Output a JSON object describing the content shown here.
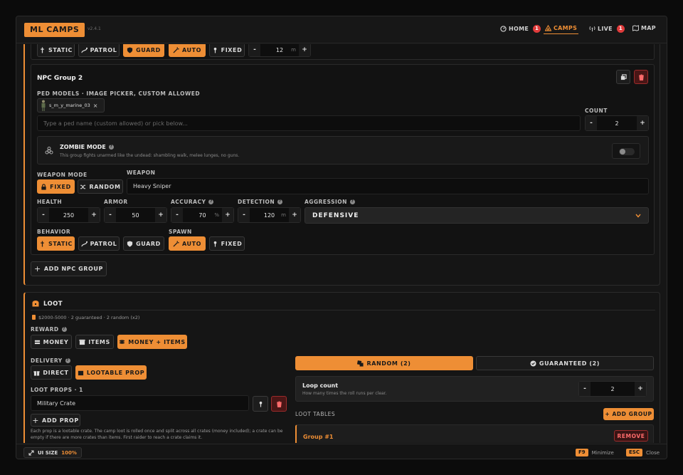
{
  "app": {
    "name": "ML CAMPS",
    "version": "v2.4.1"
  },
  "nav": {
    "home": "HOME",
    "home_badge": "1",
    "camps": "CAMPS",
    "live": "LIVE",
    "live_badge": "1",
    "map": "MAP"
  },
  "top_partial": {
    "static": "STATIC",
    "patrol": "PATROL",
    "guard": "GUARD",
    "auto": "AUTO",
    "fixed": "FIXED",
    "minus": "-",
    "plus": "+",
    "value": "12",
    "unit": "m"
  },
  "npc_group": {
    "title": "NPC Group 2",
    "ped_label": "PED MODELS · IMAGE PICKER, CUSTOM ALLOWED",
    "ped_chip": "s_m_y_marine_03",
    "ped_chip_remove": "×",
    "ped_placeholder": "Type a ped name (custom allowed) or pick below...",
    "count_label": "COUNT",
    "count": "2",
    "zombie_title": "ZOMBIE MODE",
    "zombie_desc": "This group fights unarmed like the undead: shambling walk, melee lunges, no guns.",
    "weapon_mode_label": "WEAPON MODE",
    "fixed": "FIXED",
    "random": "RANDOM",
    "weapon_label": "WEAPON",
    "weapon": "Heavy Sniper",
    "health_label": "HEALTH",
    "health": "250",
    "armor_label": "ARMOR",
    "armor": "50",
    "accuracy_label": "ACCURACY",
    "accuracy": "70",
    "accuracy_unit": "%",
    "detection_label": "DETECTION",
    "detection": "120",
    "detection_unit": "m",
    "aggression_label": "AGGRESSION",
    "aggression": "DEFENSIVE",
    "behavior_label": "BEHAVIOR",
    "static": "STATIC",
    "patrol": "PATROL",
    "guard": "GUARD",
    "spawn_label": "SPAWN",
    "auto": "AUTO",
    "spawn_fixed": "FIXED",
    "minus": "-",
    "plus": "+"
  },
  "add_npc_group": "ADD NPC GROUP",
  "loot": {
    "title": "LOOT",
    "summary": "$2000-5000 · 2 guaranteed · 2 random (x2)",
    "reward_label": "REWARD",
    "money": "MONEY",
    "items": "ITEMS",
    "money_items": "MONEY + ITEMS",
    "delivery_label": "DELIVERY",
    "direct": "DIRECT",
    "lootable_prop": "LOOTABLE PROP",
    "props_label": "LOOT PROPS · 1",
    "prop": "Military Crate",
    "add_prop": "ADD PROP",
    "props_note": "Each prop is a lootable crate. The camp loot is rolled once and split across all crates (money included); a crate can be empty if there are more crates than items. First raider to reach a crate claims it.",
    "tab_random": "RANDOM (2)",
    "tab_guaranteed": "GUARANTEED (2)",
    "loop_title": "Loop count",
    "loop_desc": "How many times the roll runs per clear.",
    "loop_value": "2",
    "tables_label": "LOOT TABLES",
    "add_group": "+ ADD GROUP",
    "group_name": "Group #1",
    "remove": "REMOVE",
    "minus": "-",
    "plus": "+"
  },
  "footer": {
    "ui_size_label": "UI SIZE",
    "ui_size_value": "100%",
    "f9": "F9",
    "minimize": "Minimize",
    "esc": "ESC",
    "close": "Close"
  },
  "colors": {
    "accent": "#ee8e35",
    "danger": "#e03b3b",
    "bg": "#161616"
  }
}
